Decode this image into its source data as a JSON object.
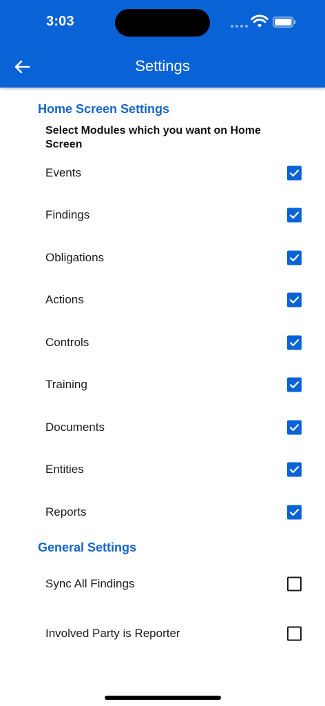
{
  "status_bar": {
    "time": "3:03"
  },
  "header": {
    "title": "Settings"
  },
  "home_screen_settings": {
    "section_title": "Home Screen Settings",
    "prompt": "Select Modules which you want on Home Screen",
    "items": [
      {
        "label": "Events",
        "checked": true
      },
      {
        "label": "Findings",
        "checked": true
      },
      {
        "label": "Obligations",
        "checked": true
      },
      {
        "label": "Actions",
        "checked": true
      },
      {
        "label": "Controls",
        "checked": true
      },
      {
        "label": "Training",
        "checked": true
      },
      {
        "label": "Documents",
        "checked": true
      },
      {
        "label": "Entities",
        "checked": true
      },
      {
        "label": "Reports",
        "checked": true
      }
    ]
  },
  "general_settings": {
    "section_title": "General Settings",
    "items": [
      {
        "label": "Sync All Findings",
        "checked": false
      },
      {
        "label": "Involved Party is Reporter",
        "checked": false
      }
    ]
  },
  "colors": {
    "accent": "#0A63D6",
    "section_title": "#1565C9",
    "text": "#1a1a1a"
  }
}
